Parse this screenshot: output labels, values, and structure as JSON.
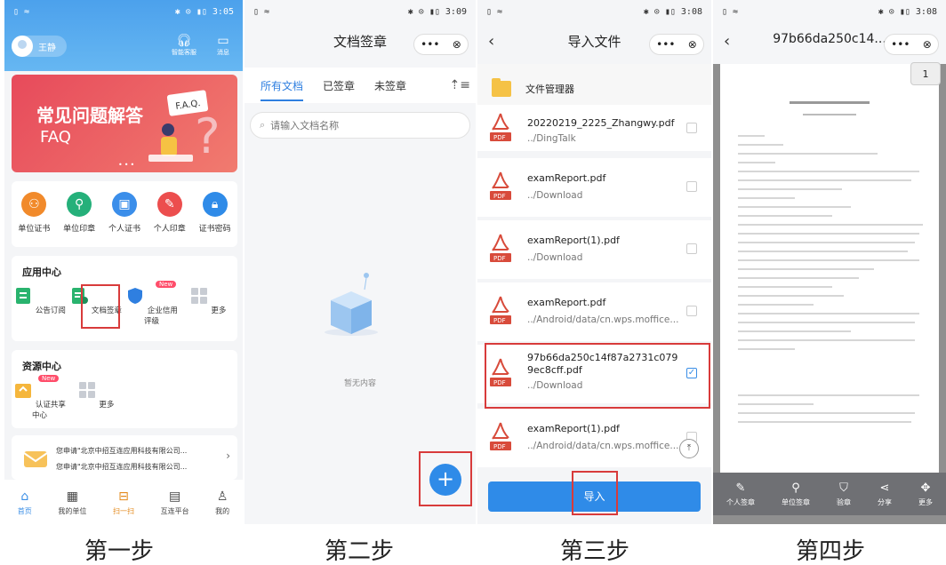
{
  "captions": [
    "第一步",
    "第二步",
    "第三步",
    "第四步"
  ],
  "p1": {
    "time": "3:05",
    "user_name": "王静",
    "top_buttons": [
      "智能客服",
      "消息"
    ],
    "banner_title": "常见问题解答",
    "banner_sub": "FAQ",
    "banner_art_text": "F.A.Q.",
    "cert_items": [
      "单位证书",
      "单位印章",
      "个人证书",
      "个人印章",
      "证书密码"
    ],
    "app_center_title": "应用中心",
    "app_items": [
      "公告订阅",
      "文档签章",
      "企业信用评级",
      "更多"
    ],
    "new_badge": "New",
    "resource_center_title": "资源中心",
    "resource_items": [
      "认证共享中心",
      "更多"
    ],
    "messages": [
      "您申请\"北京中招互连应用科技有限公司...",
      "您申请\"北京中招互连应用科技有限公司..."
    ],
    "tabs": [
      "首页",
      "我的单位",
      "扫一扫",
      "互连平台",
      "我的"
    ]
  },
  "p2": {
    "time": "3:09",
    "title": "文档签章",
    "tabs": [
      "所有文档",
      "已签章",
      "未签章"
    ],
    "search_placeholder": "请输入文档名称",
    "empty_text": "暂无内容"
  },
  "p3": {
    "time": "3:08",
    "title": "导入文件",
    "file_manager": "文件管理器",
    "files": [
      {
        "name": "20220219_2225_Zhangwy.pdf",
        "path": "../DingTalk",
        "checked": false
      },
      {
        "name": "examReport.pdf",
        "path": "../Download",
        "checked": false
      },
      {
        "name": "examReport(1).pdf",
        "path": "../Download",
        "checked": false
      },
      {
        "name": "examReport.pdf",
        "path": "../Android/data/cn.wps.moffice...",
        "checked": false
      },
      {
        "name": "97b66da250c14f87a2731c0799ec8cff.pdf",
        "path": "../Download",
        "checked": true
      },
      {
        "name": "examReport(1).pdf",
        "path": "../Android/data/cn.wps.moffice...",
        "checked": false
      }
    ],
    "pdf_tag": "PDF",
    "import_button": "导入"
  },
  "p4": {
    "time": "3:08",
    "title": "97b66da250c14...",
    "page_no": "1",
    "tools": [
      "个人签章",
      "单位签章",
      "验章",
      "分享",
      "更多"
    ]
  },
  "colors": {
    "primary": "#2f8be8",
    "highlight": "#d83b3b"
  }
}
